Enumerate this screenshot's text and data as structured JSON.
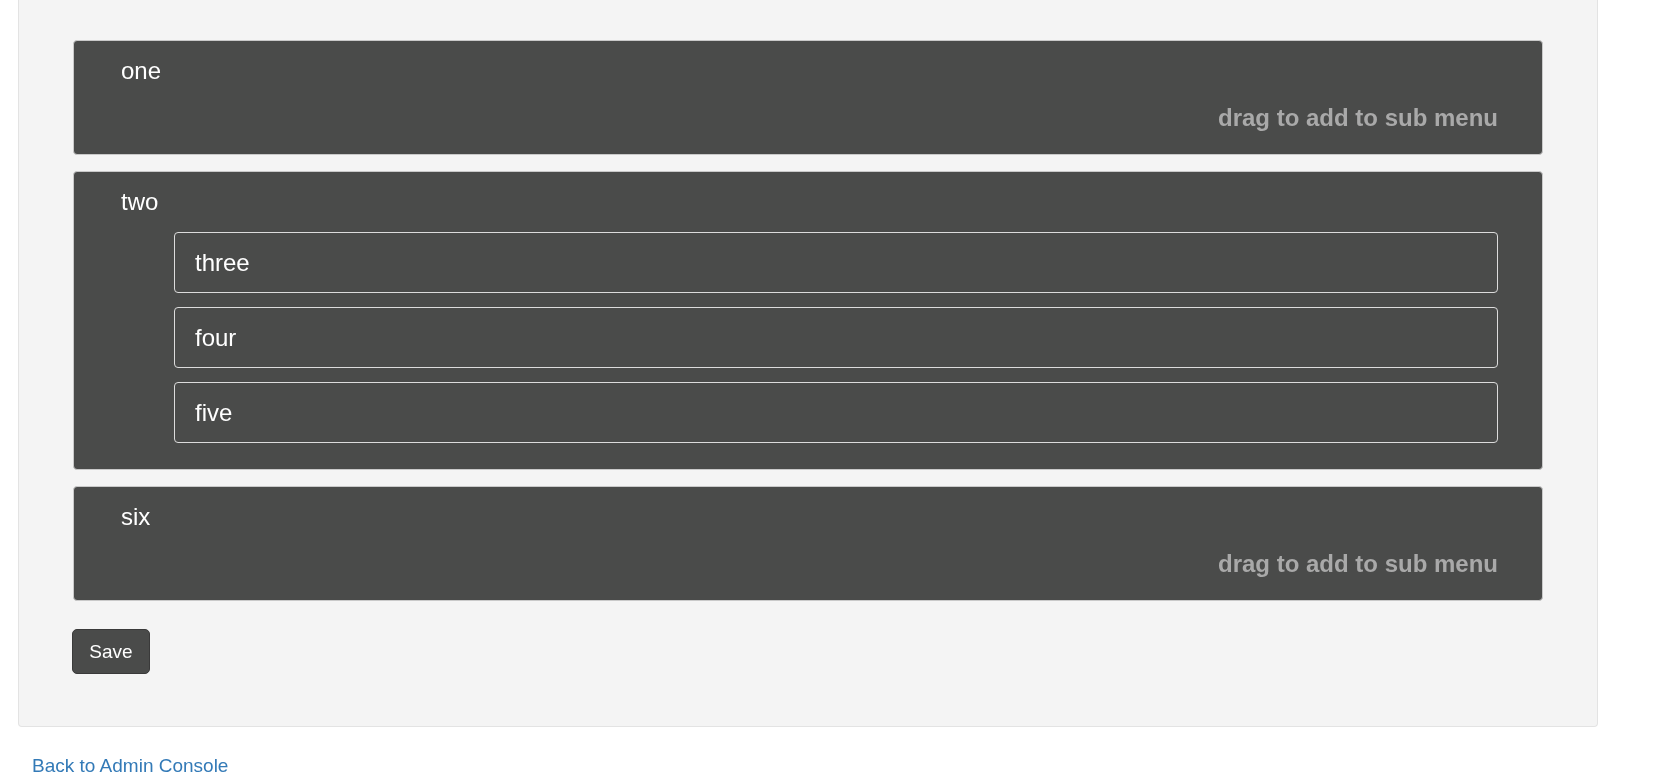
{
  "menu_items": [
    {
      "label": "one",
      "hint": "drag to add to sub menu"
    },
    {
      "label": "two",
      "children": [
        {
          "label": "three"
        },
        {
          "label": "four"
        },
        {
          "label": "five"
        }
      ]
    },
    {
      "label": "six",
      "hint": "drag to add to sub menu"
    }
  ],
  "save_button": {
    "label": "Save"
  },
  "back_link": {
    "label": "Back to Admin Console"
  }
}
